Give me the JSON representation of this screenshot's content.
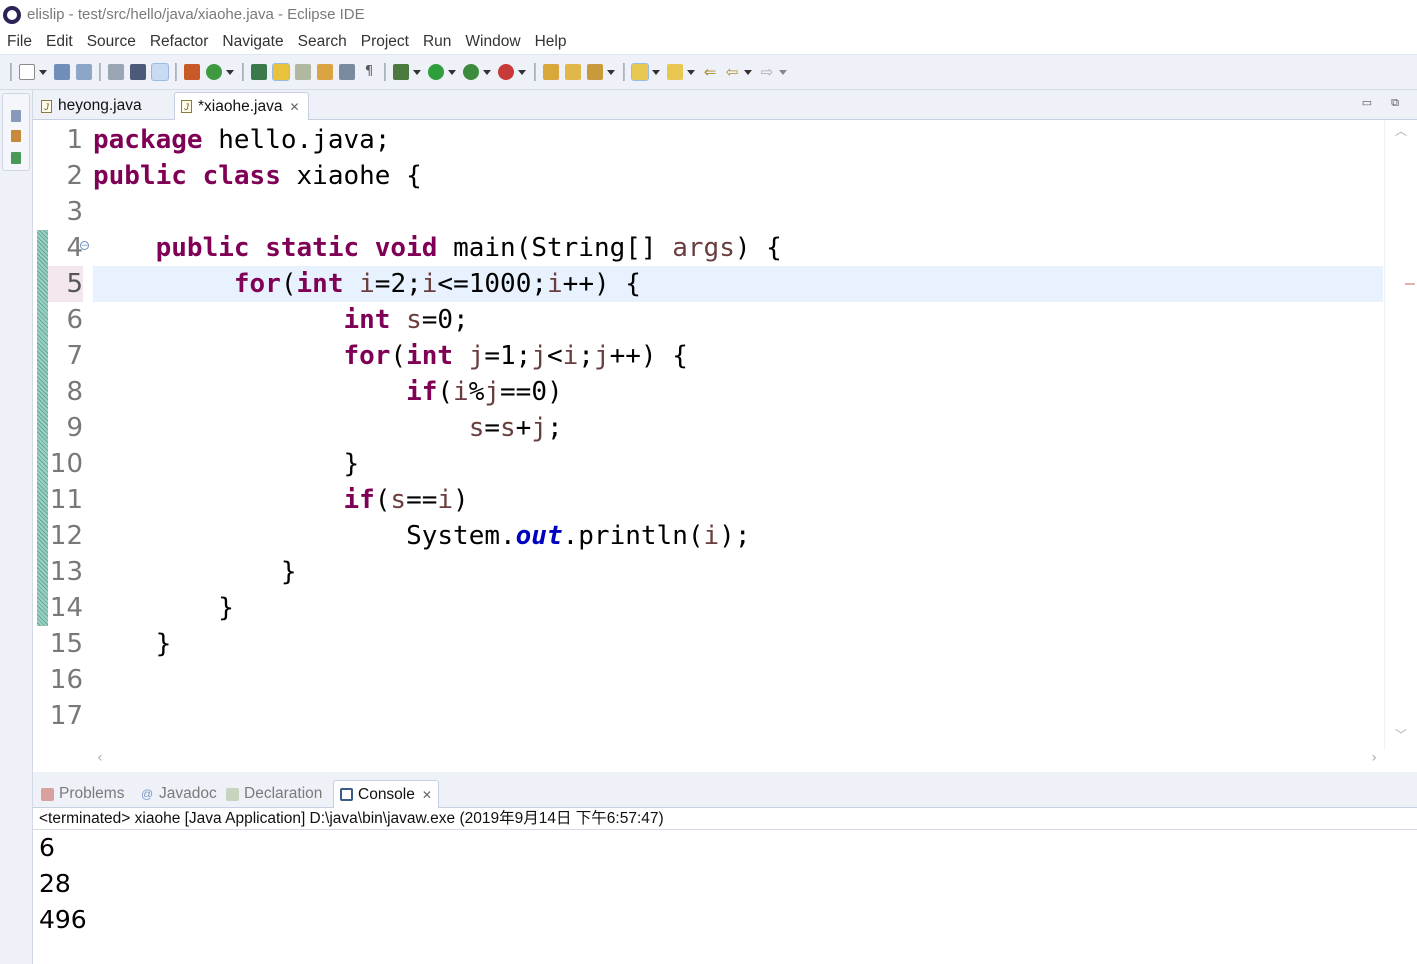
{
  "window": {
    "title": "elislip - test/src/hello/java/xiaohe.java - Eclipse IDE"
  },
  "menu": [
    "File",
    "Edit",
    "Source",
    "Refactor",
    "Navigate",
    "Search",
    "Project",
    "Run",
    "Window",
    "Help"
  ],
  "editor": {
    "tabs": [
      {
        "label": "heyong.java",
        "active": false,
        "dirty": false
      },
      {
        "label": "*xiaohe.java",
        "active": true,
        "dirty": true
      }
    ],
    "current_line": 5,
    "line_numbers": [
      "1",
      "2",
      "3",
      "4",
      "5",
      "6",
      "7",
      "8",
      "9",
      "10",
      "11",
      "12",
      "13",
      "14",
      "15",
      "16",
      "17"
    ],
    "code_lines": [
      "package hello.java;",
      "public class xiaohe {",
      "",
      "    public static void main(String[] args) {",
      "         for(int i=2;i<=1000;i++) {",
      "                int s=0;",
      "                for(int j=1;j<i;j++) {",
      "                    if(i%j==0)",
      "                        s=s+j;",
      "                }",
      "                if(s==i)",
      "                    System.out.println(i);",
      "            }",
      "        }",
      "    }",
      "",
      ""
    ]
  },
  "bottom_panel": {
    "tabs": [
      {
        "label": "Problems",
        "active": false
      },
      {
        "label": "Javadoc",
        "active": false
      },
      {
        "label": "Declaration",
        "active": false
      },
      {
        "label": "Console",
        "active": true
      }
    ],
    "console_header": "<terminated> xiaohe [Java Application] D:\\java\\bin\\javaw.exe (2019年9月14日 下午6:57:47)",
    "output": [
      "6",
      "28",
      "496"
    ]
  },
  "colors": {
    "keyword": "#7f0055",
    "local_variable": "#6a3e3e",
    "static_field": "#0000c0",
    "current_line_bg": "#e8f2fe",
    "toolbar_bg": "#eef1f8"
  }
}
